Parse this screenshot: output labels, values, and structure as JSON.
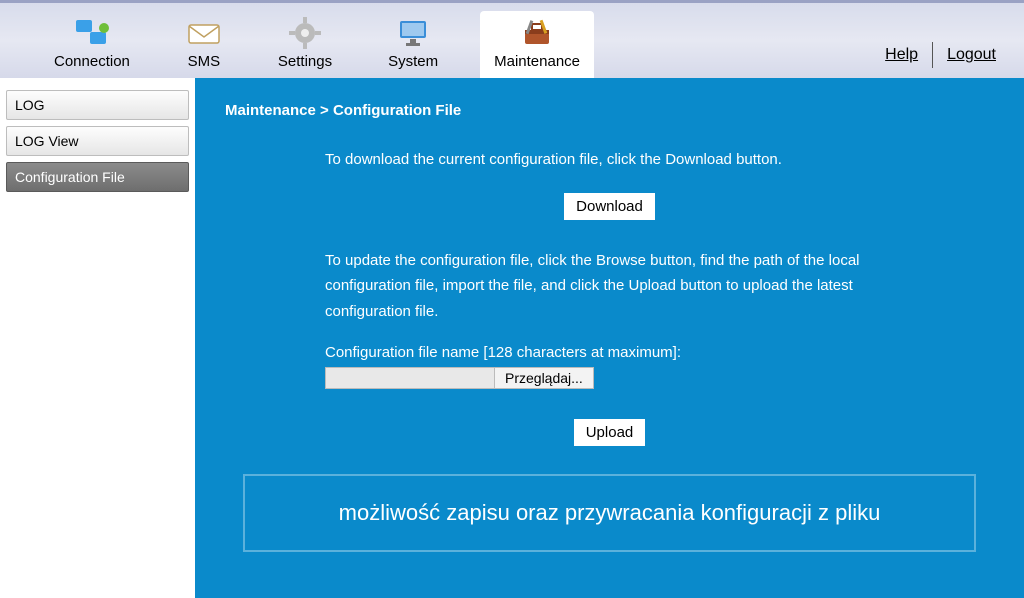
{
  "nav": {
    "items": [
      {
        "label": "Connection"
      },
      {
        "label": "SMS"
      },
      {
        "label": "Settings"
      },
      {
        "label": "System"
      },
      {
        "label": "Maintenance"
      }
    ],
    "help": "Help",
    "logout": "Logout"
  },
  "sidebar": {
    "items": [
      {
        "label": "LOG"
      },
      {
        "label": "LOG View"
      },
      {
        "label": "Configuration File"
      }
    ]
  },
  "content": {
    "breadcrumb": "Maintenance > Configuration File",
    "download_instruction": "To download the current configuration file, click the Download button.",
    "download_button": "Download",
    "upload_instruction": "To update the configuration file, click the Browse button, find the path of the local configuration file, import the file, and click the Upload button to upload the latest configuration file.",
    "file_field_label": "Configuration file name [128 characters at maximum]:",
    "file_value": "",
    "browse_button": "Przeglądaj...",
    "upload_button": "Upload",
    "annotation": "możliwość zapisu oraz przywracania konfiguracji z pliku"
  }
}
